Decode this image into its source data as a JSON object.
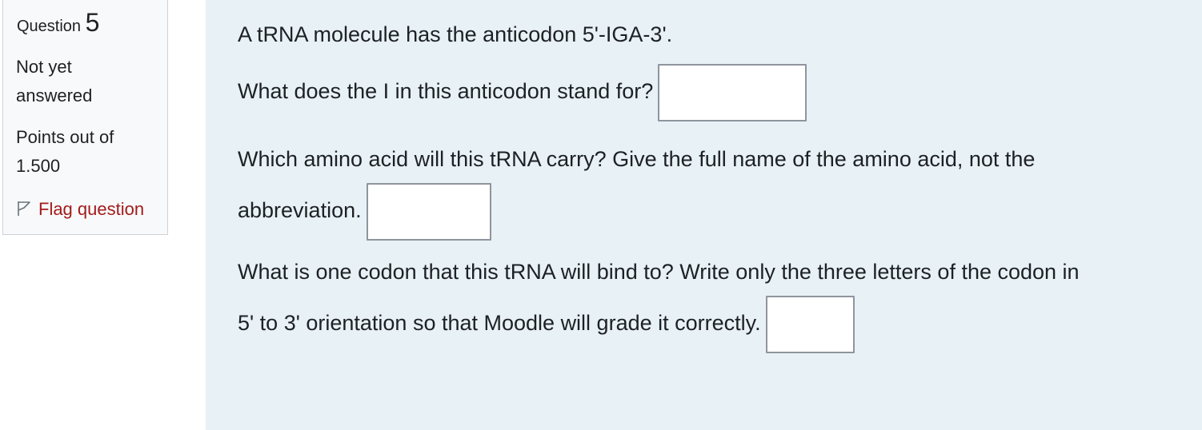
{
  "info": {
    "question_label": "Question",
    "question_number": "5",
    "state": "Not yet answered",
    "grade": "Points out of 1.500",
    "flag_label": "Flag question"
  },
  "question": {
    "intro": "A tRNA molecule has the anticodon 5'-IGA-3'.",
    "q1": {
      "text": "What does the I in this anticodon stand for?",
      "answer": ""
    },
    "q2": {
      "line1": "Which amino acid will this tRNA carry? Give the full name of the amino acid, not the",
      "line2": "abbreviation.",
      "answer": ""
    },
    "q3": {
      "line1": "What is one codon that this tRNA will bind to? Write only the three letters of the codon in",
      "line2": "5' to 3' orientation so that Moodle will grade it correctly.",
      "answer": ""
    }
  },
  "colors": {
    "content_background": "#e8f1f5",
    "info_background": "#f8f9fa",
    "flag_link": "#a31b1b"
  }
}
